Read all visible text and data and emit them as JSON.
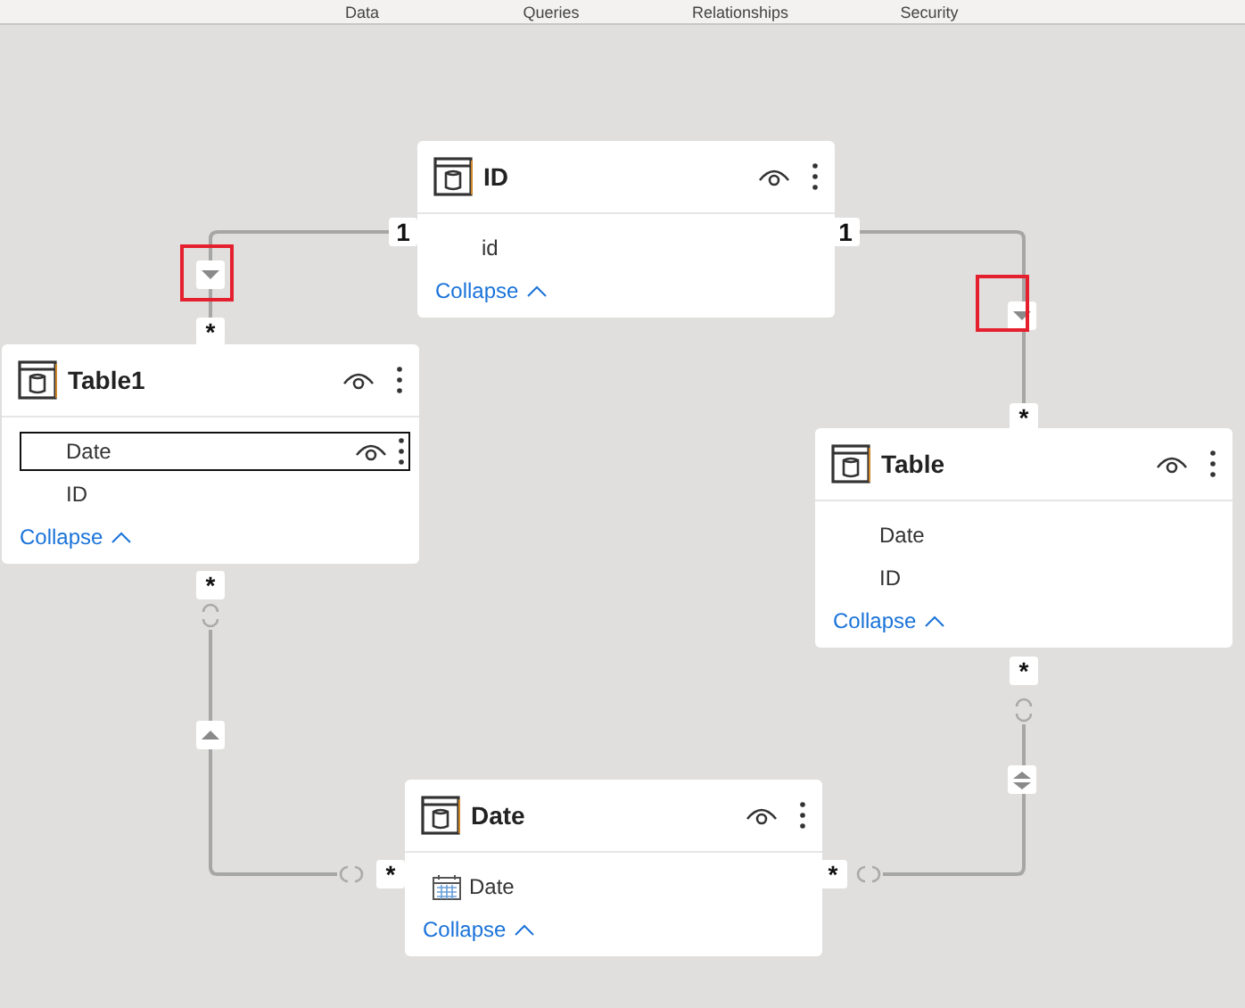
{
  "top_tabs": [
    {
      "label": "Data"
    },
    {
      "label": "Queries"
    },
    {
      "label": "Relationships"
    },
    {
      "label": "Security"
    }
  ],
  "tables": [
    {
      "name": "ID",
      "fields": [
        {
          "name": "id",
          "kind": "plain",
          "selected": false
        }
      ],
      "collapse": "Collapse"
    },
    {
      "name": "Table1",
      "fields": [
        {
          "name": "Date",
          "kind": "plain",
          "selected": true
        },
        {
          "name": "ID",
          "kind": "plain",
          "selected": false
        }
      ],
      "collapse": "Collapse"
    },
    {
      "name": "Table",
      "fields": [
        {
          "name": "Date",
          "kind": "plain",
          "selected": false
        },
        {
          "name": "ID",
          "kind": "plain",
          "selected": false
        }
      ],
      "collapse": "Collapse"
    },
    {
      "name": "Date",
      "fields": [
        {
          "name": "Date",
          "kind": "date",
          "selected": false
        }
      ],
      "collapse": "Collapse"
    }
  ],
  "relationships": [
    {
      "one_end": "1",
      "many_end": "*",
      "kind": "down",
      "highlighted": true
    },
    {
      "one_end": "1",
      "many_end": "*",
      "kind": "down",
      "highlighted": true
    },
    {
      "one_end": "*",
      "many_end": "*",
      "kind": "up",
      "highlighted": false
    },
    {
      "one_end": "*",
      "many_end": "*",
      "kind": "both",
      "highlighted": false
    }
  ]
}
